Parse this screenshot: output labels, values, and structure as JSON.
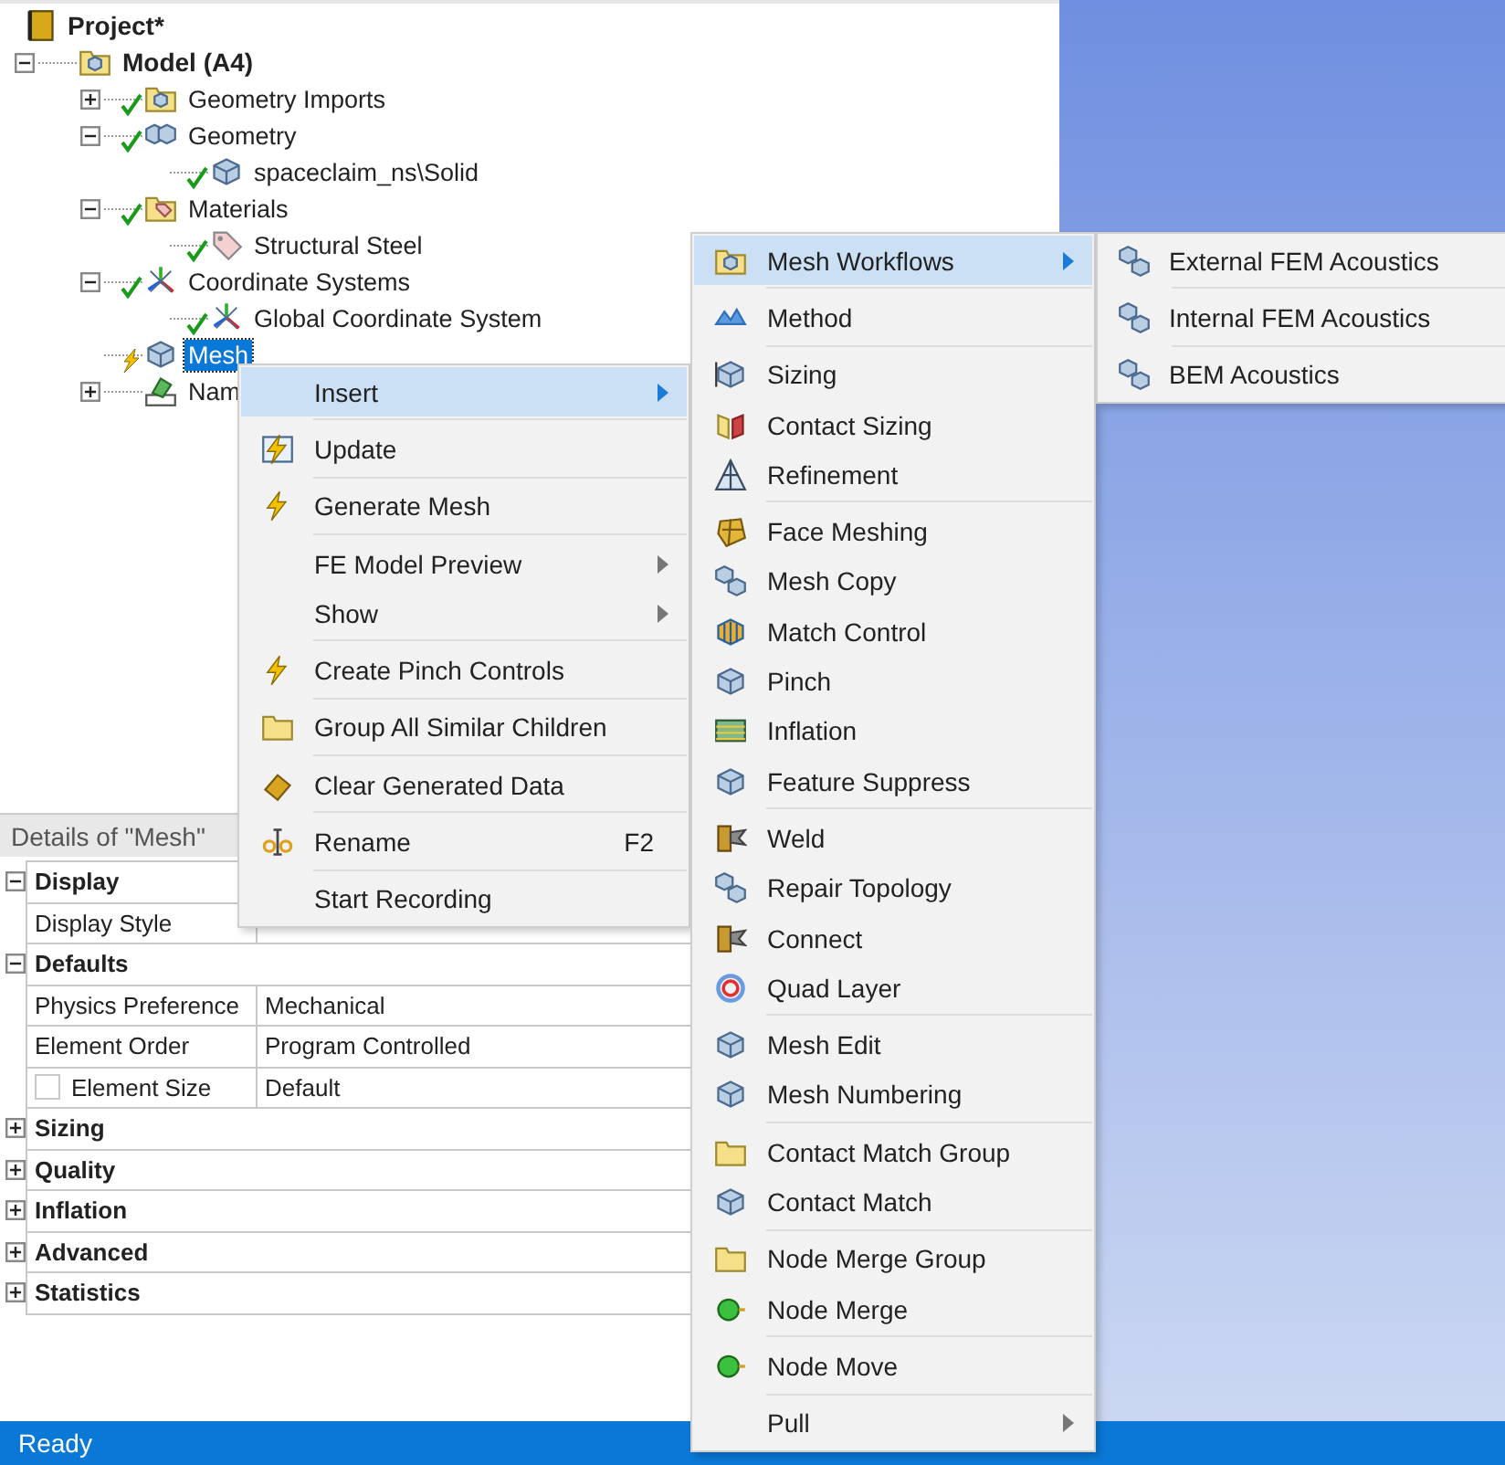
{
  "tree": [
    {
      "label": "Project*",
      "kind": "project",
      "selected": false,
      "children": [
        {
          "label": "Model (A4)",
          "kind": "model",
          "selected": false,
          "expanded": true,
          "children": [
            {
              "label": "Geometry Imports",
              "kind": "import",
              "up_to_date": true,
              "selected": false,
              "expanded": false
            },
            {
              "label": "Geometry",
              "kind": "geometry",
              "up_to_date": true,
              "selected": false,
              "expanded": true,
              "children": [
                {
                  "label": "spaceclaim_ns\\Solid",
                  "kind": "part",
                  "up_to_date": true,
                  "selected": false
                }
              ]
            },
            {
              "label": "Materials",
              "kind": "materials",
              "up_to_date": true,
              "selected": false,
              "expanded": true,
              "children": [
                {
                  "label": "Structural Steel",
                  "kind": "material",
                  "up_to_date": true,
                  "selected": false
                }
              ]
            },
            {
              "label": "Coordinate Systems",
              "kind": "coords",
              "up_to_date": true,
              "selected": false,
              "expanded": true,
              "children": [
                {
                  "label": "Global Coordinate System",
                  "kind": "coords",
                  "up_to_date": true,
                  "selected": false
                }
              ]
            },
            {
              "label": "Mesh",
              "kind": "mesh",
              "up_to_date": false,
              "selected": true
            },
            {
              "label": "Nam",
              "kind": "named",
              "selected": false,
              "expanded": false
            }
          ]
        }
      ]
    }
  ],
  "details": {
    "title": "Details of \"Mesh\"",
    "rows": [
      {
        "kind": "category",
        "label": "Display",
        "expanded": true
      },
      {
        "kind": "property",
        "label": "Display Style"
      },
      {
        "kind": "category",
        "label": "Defaults",
        "expanded": true
      },
      {
        "kind": "property",
        "label": "Physics Preference",
        "value": "Mechanical"
      },
      {
        "kind": "property",
        "label": "Element Order",
        "value": "Program Controlled"
      },
      {
        "kind": "property",
        "label": "Element Size",
        "value": "Default",
        "checked": false
      },
      {
        "kind": "category",
        "label": "Sizing",
        "expanded": false
      },
      {
        "kind": "category",
        "label": "Quality",
        "expanded": false
      },
      {
        "kind": "category",
        "label": "Inflation",
        "expanded": false
      },
      {
        "kind": "category",
        "label": "Advanced",
        "expanded": false
      },
      {
        "kind": "category",
        "label": "Statistics",
        "expanded": false
      }
    ]
  },
  "context_menu": {
    "groups": [
      {
        "items": [
          {
            "label": "Insert",
            "kind": "none",
            "submenu": true,
            "selected": true
          }
        ]
      },
      {
        "items": [
          {
            "label": "Update",
            "kind": "update",
            "submenu": false,
            "selected": false
          }
        ]
      },
      {
        "items": [
          {
            "label": "Generate Mesh",
            "kind": "bolt",
            "submenu": false,
            "selected": false
          }
        ]
      },
      {
        "items": [
          {
            "label": "FE Model Preview",
            "kind": "none",
            "submenu": true,
            "selected": false
          },
          {
            "label": "Show",
            "kind": "none",
            "submenu": true,
            "selected": false
          }
        ]
      },
      {
        "items": [
          {
            "label": "Create Pinch Controls",
            "kind": "bolt",
            "submenu": false,
            "selected": false
          }
        ]
      },
      {
        "items": [
          {
            "label": "Group All Similar Children",
            "kind": "folder",
            "submenu": false,
            "selected": false
          }
        ]
      },
      {
        "items": [
          {
            "label": "Clear Generated Data",
            "kind": "eraser",
            "submenu": false,
            "selected": false
          }
        ]
      },
      {
        "items": [
          {
            "label": "Rename",
            "kind": "rename",
            "submenu": false,
            "selected": false,
            "shortcut": "F2"
          }
        ]
      },
      {
        "items": [
          {
            "label": "Start Recording",
            "kind": "none",
            "submenu": false,
            "selected": false
          }
        ]
      }
    ]
  },
  "insert_menu": {
    "groups": [
      {
        "items": [
          {
            "label": "Mesh Workflows",
            "kind": "workflow",
            "submenu": true,
            "selected": true
          }
        ]
      },
      {
        "items": [
          {
            "label": "Method",
            "kind": "method",
            "submenu": false,
            "selected": false
          }
        ]
      },
      {
        "items": [
          {
            "label": "Sizing",
            "kind": "sizing",
            "submenu": false,
            "selected": false
          },
          {
            "label": "Contact Sizing",
            "kind": "contact",
            "submenu": false,
            "selected": false
          },
          {
            "label": "Refinement",
            "kind": "triangle",
            "submenu": false,
            "selected": false
          }
        ]
      },
      {
        "items": [
          {
            "label": "Face Meshing",
            "kind": "facemesh",
            "submenu": false,
            "selected": false
          },
          {
            "label": "Mesh Copy",
            "kind": "twocubes",
            "submenu": false,
            "selected": false
          },
          {
            "label": "Match Control",
            "kind": "match",
            "submenu": false,
            "selected": false
          },
          {
            "label": "Pinch",
            "kind": "cube",
            "submenu": false,
            "selected": false
          },
          {
            "label": "Inflation",
            "kind": "layers",
            "submenu": false,
            "selected": false
          },
          {
            "label": "Feature Suppress",
            "kind": "cube",
            "submenu": false,
            "selected": false
          }
        ]
      },
      {
        "items": [
          {
            "label": "Weld",
            "kind": "weld",
            "submenu": false,
            "selected": false
          },
          {
            "label": "Repair Topology",
            "kind": "twocubes",
            "submenu": false,
            "selected": false
          },
          {
            "label": "Connect",
            "kind": "weld",
            "submenu": false,
            "selected": false
          },
          {
            "label": "Quad Layer",
            "kind": "ring",
            "submenu": false,
            "selected": false
          }
        ]
      },
      {
        "items": [
          {
            "label": "Mesh Edit",
            "kind": "cube",
            "submenu": false,
            "selected": false
          },
          {
            "label": "Mesh Numbering",
            "kind": "cube",
            "submenu": false,
            "selected": false
          }
        ]
      },
      {
        "items": [
          {
            "label": "Contact Match Group",
            "kind": "folder",
            "submenu": false,
            "selected": false
          },
          {
            "label": "Contact Match",
            "kind": "cube",
            "submenu": false,
            "selected": false
          }
        ]
      },
      {
        "items": [
          {
            "label": "Node Merge Group",
            "kind": "folder",
            "submenu": false,
            "selected": false
          },
          {
            "label": "Node Merge",
            "kind": "node",
            "submenu": false,
            "selected": false
          }
        ]
      },
      {
        "items": [
          {
            "label": "Node Move",
            "kind": "node",
            "submenu": false,
            "selected": false
          }
        ]
      },
      {
        "items": [
          {
            "label": "Pull",
            "kind": "none",
            "submenu": true,
            "selected": false
          }
        ]
      }
    ]
  },
  "workflow_menu": {
    "groups": [
      {
        "items": [
          {
            "label": "External FEM Acoustics",
            "kind": "twocubes",
            "submenu": false,
            "selected": false
          }
        ]
      },
      {
        "items": [
          {
            "label": "Internal FEM Acoustics",
            "kind": "twocubes",
            "submenu": false,
            "selected": false
          }
        ]
      },
      {
        "items": [
          {
            "label": "BEM Acoustics",
            "kind": "twocubes",
            "submenu": false,
            "selected": false
          }
        ]
      }
    ]
  },
  "status_bar": {
    "text": "Ready"
  }
}
